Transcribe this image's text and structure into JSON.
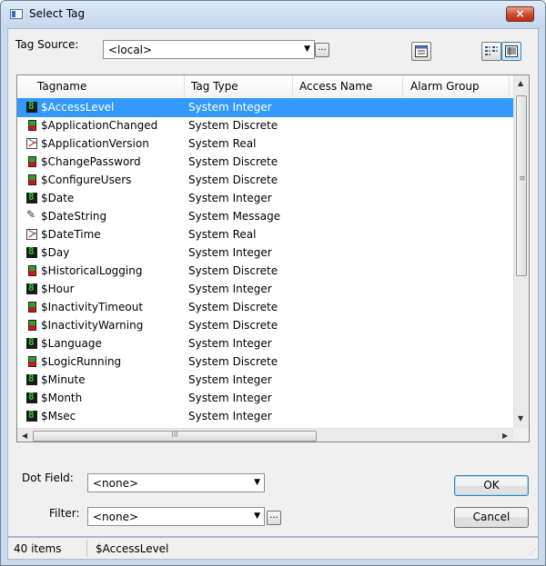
{
  "window": {
    "title": "Select Tag",
    "close_label": "×"
  },
  "tag_source": {
    "label": "Tag Source:",
    "value": "<local>",
    "browse_label": "..."
  },
  "toolbar": {
    "buttons": [
      "properties-view-icon",
      "list-view-icon",
      "details-view-icon"
    ]
  },
  "list": {
    "columns": [
      "Tagname",
      "Tag Type",
      "Access Name",
      "Alarm Group"
    ],
    "rows": [
      {
        "name": "$AccessLevel",
        "type": "System Integer",
        "icon": "integer-tag-icon",
        "selected": true
      },
      {
        "name": "$ApplicationChanged",
        "type": "System Discrete",
        "icon": "discrete-tag-icon"
      },
      {
        "name": "$ApplicationVersion",
        "type": "System Real",
        "icon": "real-tag-icon"
      },
      {
        "name": "$ChangePassword",
        "type": "System Discrete",
        "icon": "discrete-tag-icon"
      },
      {
        "name": "$ConfigureUsers",
        "type": "System Discrete",
        "icon": "discrete-tag-icon"
      },
      {
        "name": "$Date",
        "type": "System Integer",
        "icon": "integer-tag-icon"
      },
      {
        "name": "$DateString",
        "type": "System Message",
        "icon": "message-tag-icon"
      },
      {
        "name": "$DateTime",
        "type": "System Real",
        "icon": "real-tag-icon"
      },
      {
        "name": "$Day",
        "type": "System Integer",
        "icon": "integer-tag-icon"
      },
      {
        "name": "$HistoricalLogging",
        "type": "System Discrete",
        "icon": "discrete-tag-icon"
      },
      {
        "name": "$Hour",
        "type": "System Integer",
        "icon": "integer-tag-icon"
      },
      {
        "name": "$InactivityTimeout",
        "type": "System Discrete",
        "icon": "discrete-tag-icon"
      },
      {
        "name": "$InactivityWarning",
        "type": "System Discrete",
        "icon": "discrete-tag-icon"
      },
      {
        "name": "$Language",
        "type": "System Integer",
        "icon": "integer-tag-icon"
      },
      {
        "name": "$LogicRunning",
        "type": "System Discrete",
        "icon": "discrete-tag-icon"
      },
      {
        "name": "$Minute",
        "type": "System Integer",
        "icon": "integer-tag-icon"
      },
      {
        "name": "$Month",
        "type": "System Integer",
        "icon": "integer-tag-icon"
      },
      {
        "name": "$Msec",
        "type": "System Integer",
        "icon": "integer-tag-icon"
      }
    ],
    "scroll": {
      "up": "▲",
      "down": "▼",
      "left": "◀",
      "right": "▶",
      "grip": "III"
    }
  },
  "dot_field": {
    "label": "Dot Field:",
    "value": "<none>"
  },
  "filter": {
    "label": "Filter:",
    "value": "<none>",
    "browse_label": "..."
  },
  "buttons": {
    "ok": "OK",
    "cancel": "Cancel"
  },
  "status": {
    "count": "40 items",
    "selection": "$AccessLevel"
  },
  "colors": {
    "selection": "#3399ff",
    "title_bar": "#c9daee",
    "close": "#c84a2f"
  }
}
